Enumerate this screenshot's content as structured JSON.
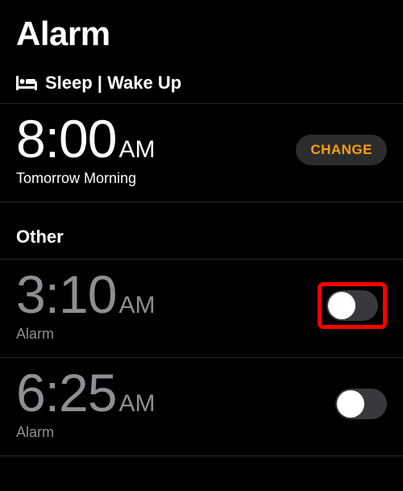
{
  "title": "Alarm",
  "sleep": {
    "section_label": "Sleep | Wake Up",
    "time": "8:00",
    "ampm": "AM",
    "subtext": "Tomorrow Morning",
    "change_label": "CHANGE"
  },
  "other": {
    "section_label": "Other",
    "alarms": [
      {
        "time": "3:10",
        "ampm": "AM",
        "label": "Alarm",
        "enabled": false,
        "highlighted": true
      },
      {
        "time": "6:25",
        "ampm": "AM",
        "label": "Alarm",
        "enabled": false,
        "highlighted": false
      }
    ]
  }
}
